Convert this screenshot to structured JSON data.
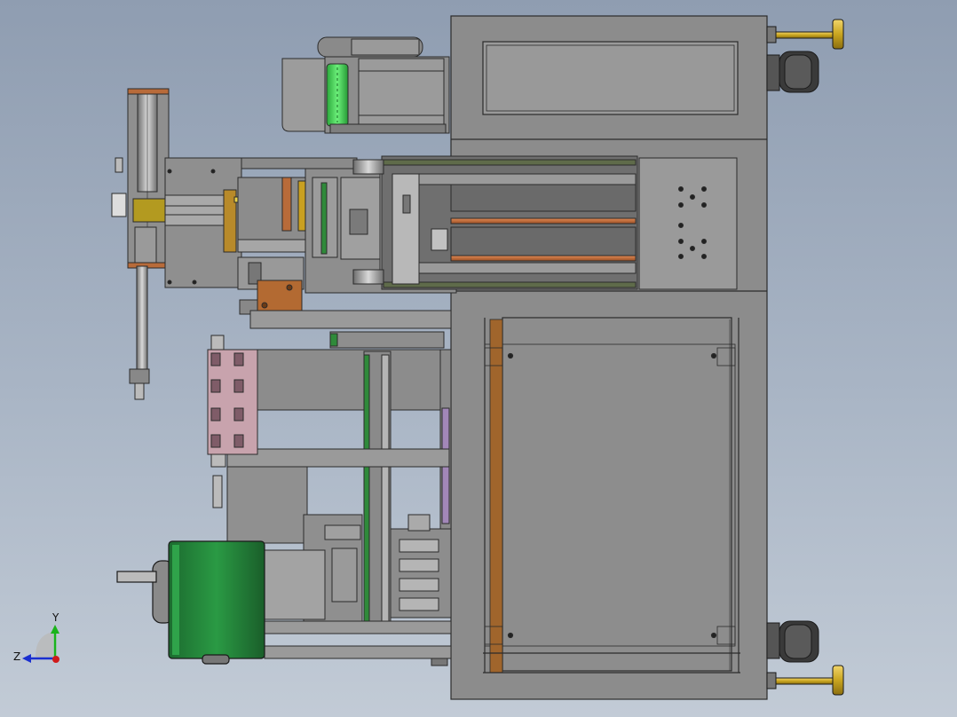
{
  "triad": {
    "y_label": "Y",
    "z_label": "Z"
  },
  "colors": {
    "background_top": "#8f9db1",
    "background_bottom": "#c2cbd6",
    "frame_gray": "#8a8a8a",
    "panel_gray": "#a3a3a3",
    "edge_dark": "#2b2b2b",
    "motor_green": "#1f7a35",
    "roller_green": "#3bcf4a",
    "copper": "#b86b3a",
    "wood_brown": "#a0652c",
    "pink_plate": "#c8a3ad",
    "brass": "#c9a520",
    "axis_y_green": "#1bb31b",
    "axis_z_blue": "#1a2fd0",
    "axis_x_red": "#d01a1a"
  },
  "icons": [
    "coordinate-triad-icon"
  ]
}
